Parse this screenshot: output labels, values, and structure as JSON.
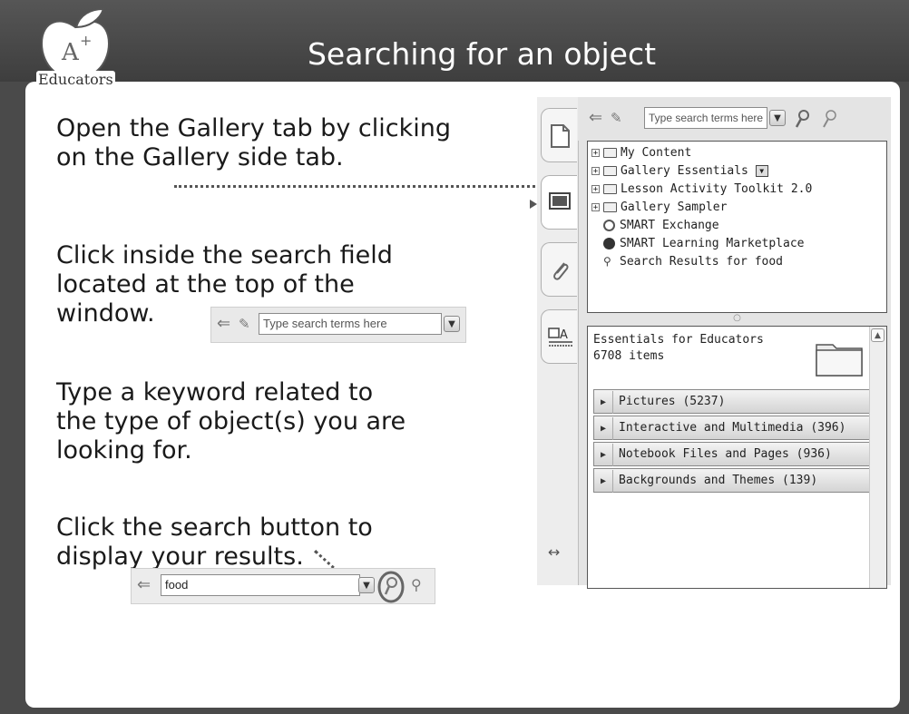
{
  "title": "Searching for an object",
  "logo": {
    "text": "Educators",
    "icon": "apple-a-plus-logo"
  },
  "instructions": {
    "step1": [
      "Open the Gallery tab by clicking",
      "on the Gallery side tab."
    ],
    "step2": [
      "Click inside the search field",
      "located at the top of the",
      "window."
    ],
    "step3": [
      "Type a keyword related to",
      "the type of object(s) you are",
      "looking for."
    ],
    "step4": [
      "Click the search button to",
      "display your results."
    ]
  },
  "search_example_1": {
    "placeholder": "Type search terms here",
    "back_icon": "back-arrow-icon",
    "pen_icon": "pen-icon"
  },
  "search_example_2": {
    "value": "food",
    "search_icon": "magnifier-icon",
    "clear_icon": "clear-search-icon"
  },
  "gallery": {
    "search_placeholder": "Type search terms here",
    "tree": [
      {
        "label": "My Content",
        "expandable": true,
        "icon": "star-folder-icon"
      },
      {
        "label": "Gallery Essentials",
        "expandable": true,
        "icon": "folder-icon",
        "menu": true
      },
      {
        "label": "Lesson Activity Toolkit 2.0",
        "expandable": true,
        "icon": "folder-icon"
      },
      {
        "label": "Gallery Sampler",
        "expandable": true,
        "icon": "folder-icon"
      },
      {
        "label": "SMART Exchange",
        "expandable": false,
        "icon": "globe-icon"
      },
      {
        "label": "SMART Learning Marketplace",
        "expandable": false,
        "icon": "marketplace-icon"
      },
      {
        "label": "Search Results for food",
        "expandable": false,
        "icon": "magnifier-icon"
      }
    ],
    "collection_title": "Essentials for Educators",
    "collection_count": "6708 items",
    "categories": [
      "Pictures (5237)",
      "Interactive and Multimedia (396)",
      "Notebook Files and Pages (936)",
      "Backgrounds and Themes (139)"
    ]
  }
}
